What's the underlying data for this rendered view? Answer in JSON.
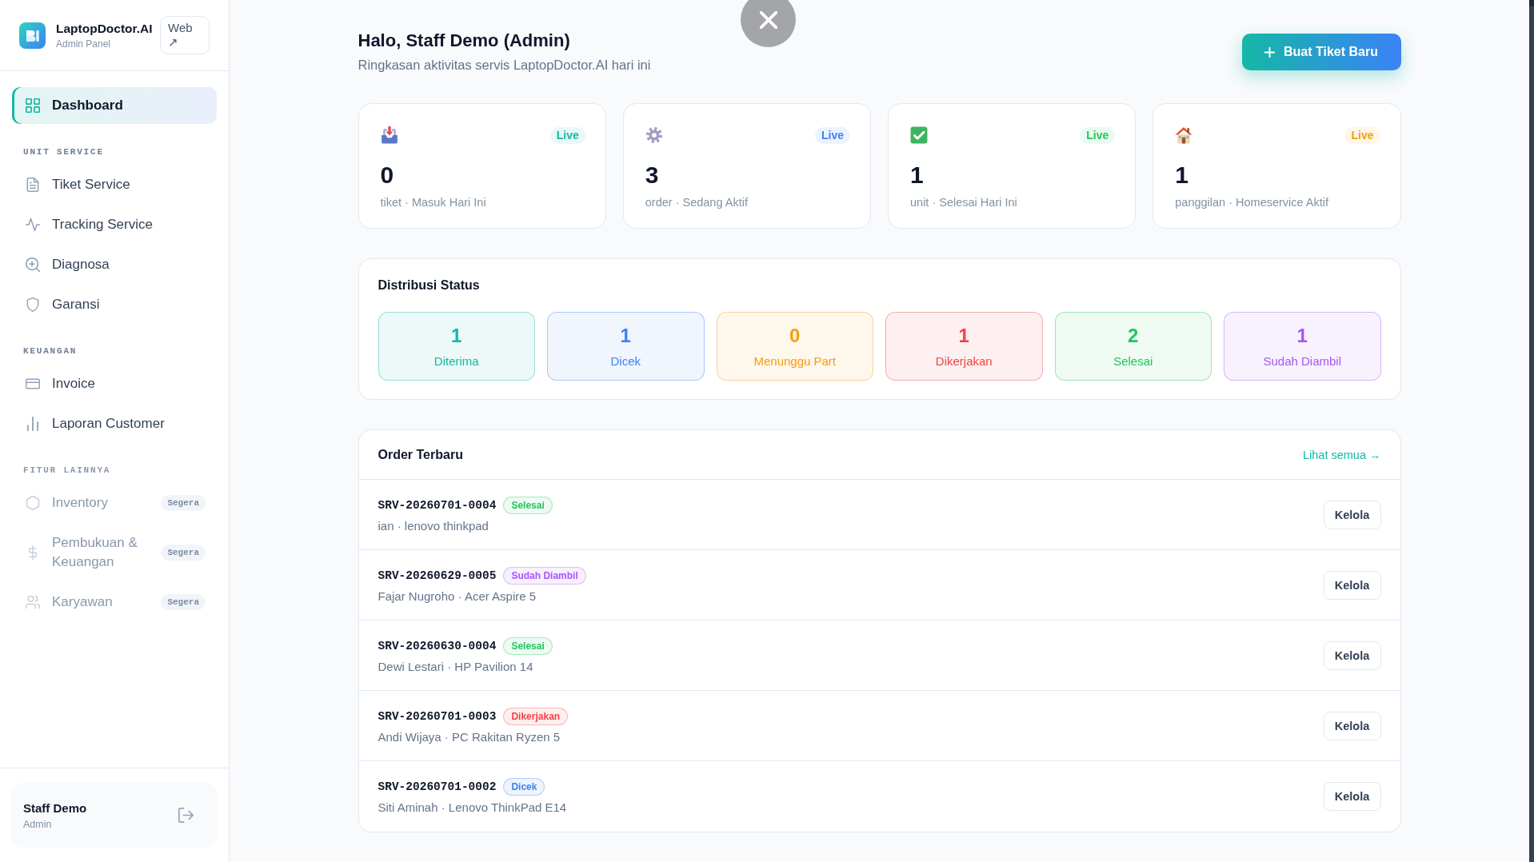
{
  "sidebar": {
    "brand": {
      "name": "LaptopDoctor.AI",
      "subtitle": "Admin Panel"
    },
    "web_button": "Web ↗",
    "sections": [
      {
        "items": [
          {
            "label": "Dashboard",
            "selected": true,
            "disabled": false
          }
        ]
      },
      {
        "title": "UNIT SERVICE",
        "items": [
          {
            "label": "Tiket Service",
            "selected": false,
            "disabled": false
          },
          {
            "label": "Tracking Service",
            "selected": false,
            "disabled": false
          },
          {
            "label": "Diagnosa",
            "selected": false,
            "disabled": false
          },
          {
            "label": "Garansi",
            "selected": false,
            "disabled": false
          }
        ]
      },
      {
        "title": "KEUANGAN",
        "items": [
          {
            "label": "Invoice",
            "selected": false,
            "disabled": false
          },
          {
            "label": "Laporan Customer",
            "selected": false,
            "disabled": false
          }
        ]
      },
      {
        "title": "FITUR LAINNYA",
        "items": [
          {
            "label": "Inventory",
            "selected": false,
            "disabled": true,
            "badge": "Segera"
          },
          {
            "label": "Pembukuan & Keuangan",
            "selected": false,
            "disabled": true,
            "badge": "Segera"
          },
          {
            "label": "Karyawan",
            "selected": false,
            "disabled": true,
            "badge": "Segera"
          }
        ]
      }
    ],
    "user": {
      "name": "Staff Demo",
      "role": "Admin"
    }
  },
  "header": {
    "title": "Halo, Staff Demo (Admin)",
    "subtitle": "Ringkasan aktivitas servis LaptopDoctor.AI hari ini",
    "button": "Buat Tiket Baru"
  },
  "stats": [
    {
      "badge": "Live",
      "color": "#14b8a6",
      "value": "0",
      "label": "tiket · Masuk Hari Ini"
    },
    {
      "badge": "Live",
      "color": "#3b82f6",
      "value": "3",
      "label": "order · Sedang Aktif"
    },
    {
      "badge": "Live",
      "color": "#22c55e",
      "value": "1",
      "label": "unit · Selesai Hari Ini"
    },
    {
      "badge": "Live",
      "color": "#f59e0b",
      "value": "1",
      "label": "panggilan · Homeservice Aktif"
    }
  ],
  "status_distribution": {
    "title": "Distribusi Status",
    "items": [
      {
        "count": "1",
        "label": "Diterima",
        "color": "#14b8a6"
      },
      {
        "count": "1",
        "label": "Dicek",
        "color": "#3b82f6"
      },
      {
        "count": "0",
        "label": "Menunggu Part",
        "color": "#f59e0b"
      },
      {
        "count": "1",
        "label": "Dikerjakan",
        "color": "#ef4444"
      },
      {
        "count": "2",
        "label": "Selesai",
        "color": "#22c55e"
      },
      {
        "count": "1",
        "label": "Sudah Diambil",
        "color": "#a855f7"
      }
    ]
  },
  "recent_orders": {
    "title": "Order Terbaru",
    "link": "Lihat semua →",
    "rows": [
      {
        "id": "SRV-20260701-0004",
        "status": "Selesai",
        "color": "#22c55e",
        "detail": "ian · lenovo thinkpad",
        "action": "Kelola"
      },
      {
        "id": "SRV-20260629-0005",
        "status": "Sudah Diambil",
        "color": "#a855f7",
        "detail": "Fajar Nugroho · Acer Aspire 5",
        "action": "Kelola"
      },
      {
        "id": "SRV-20260630-0004",
        "status": "Selesai",
        "color": "#22c55e",
        "detail": "Dewi Lestari · HP Pavilion 14",
        "action": "Kelola"
      },
      {
        "id": "SRV-20260701-0003",
        "status": "Dikerjakan",
        "color": "#ef4444",
        "detail": "Andi Wijaya · PC Rakitan Ryzen 5",
        "action": "Kelola"
      },
      {
        "id": "SRV-20260701-0002",
        "status": "Dicek",
        "color": "#3b82f6",
        "detail": "Siti Aminah · Lenovo ThinkPad E14",
        "action": "Kelola"
      }
    ]
  }
}
